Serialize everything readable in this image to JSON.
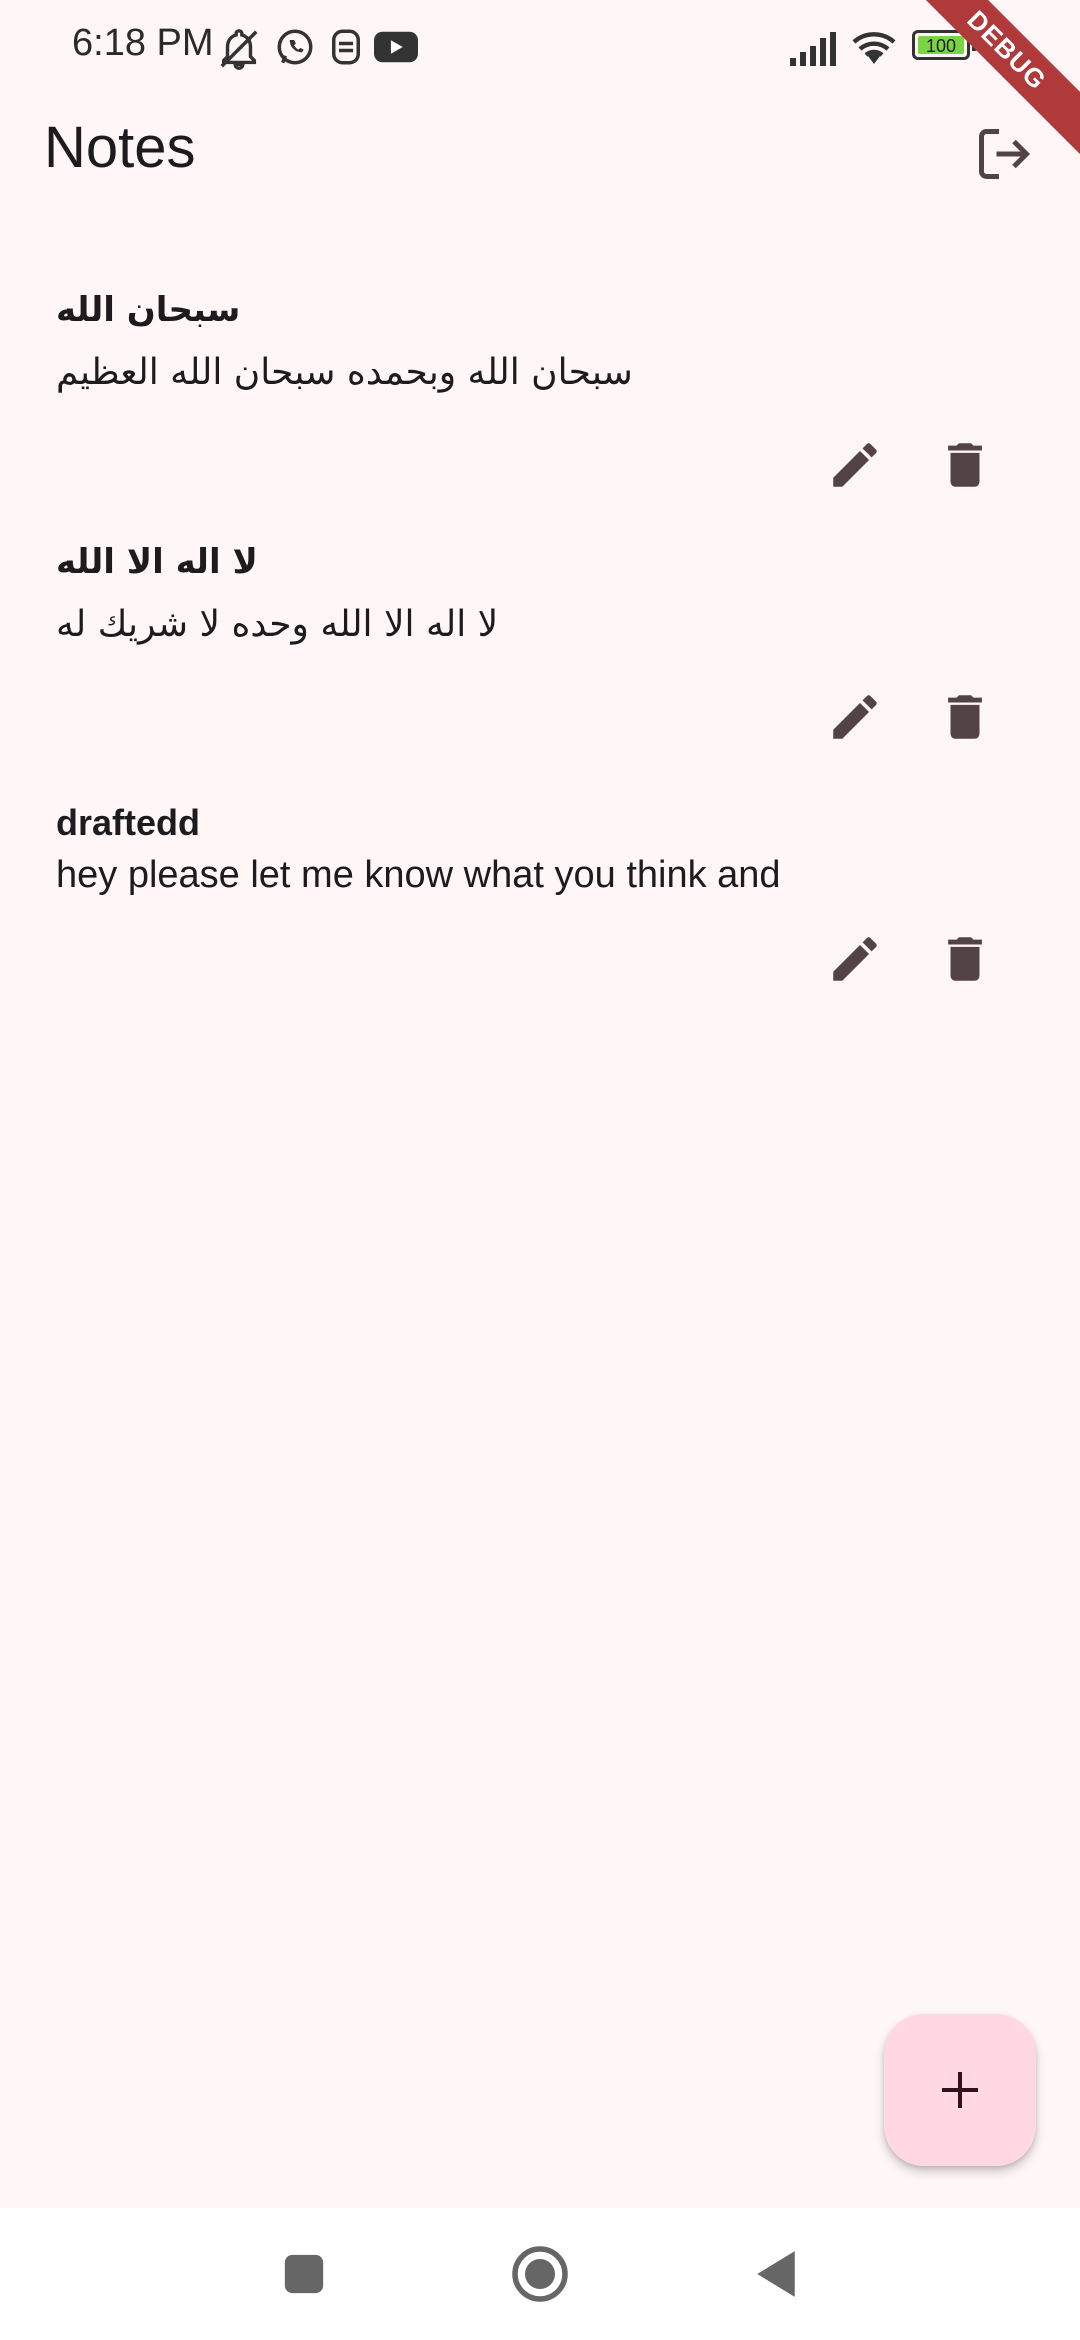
{
  "status_bar": {
    "time": "6:18 PM",
    "battery_level": "100",
    "icons": [
      "notifications-off-icon",
      "whatsapp-icon",
      "app-notification-icon",
      "youtube-icon",
      "signal-icon",
      "wifi-icon",
      "battery-icon"
    ]
  },
  "debug_banner": "DEBUG",
  "app_bar": {
    "title": "Notes",
    "action_icon": "logout-icon"
  },
  "notes": [
    {
      "title": "سبحان الله",
      "body": "سبحان الله وبحمده سبحان الله العظيم"
    },
    {
      "title": "لا اله الا الله",
      "body": "لا اله الا الله وحده لا شريك له"
    },
    {
      "title": "draftedd",
      "body": "hey please let me know what you think and"
    }
  ],
  "note_actions": [
    "edit-icon",
    "delete-icon"
  ],
  "fab": {
    "icon": "add-icon"
  },
  "nav_bar": {
    "buttons": [
      "recents-icon",
      "home-icon",
      "back-icon"
    ]
  },
  "colors": {
    "background": "#FFF7F7",
    "icon": "#534347",
    "fab": "#FFD8E4",
    "debug_ribbon": "#B03A3A",
    "battery": "#7BD443"
  }
}
